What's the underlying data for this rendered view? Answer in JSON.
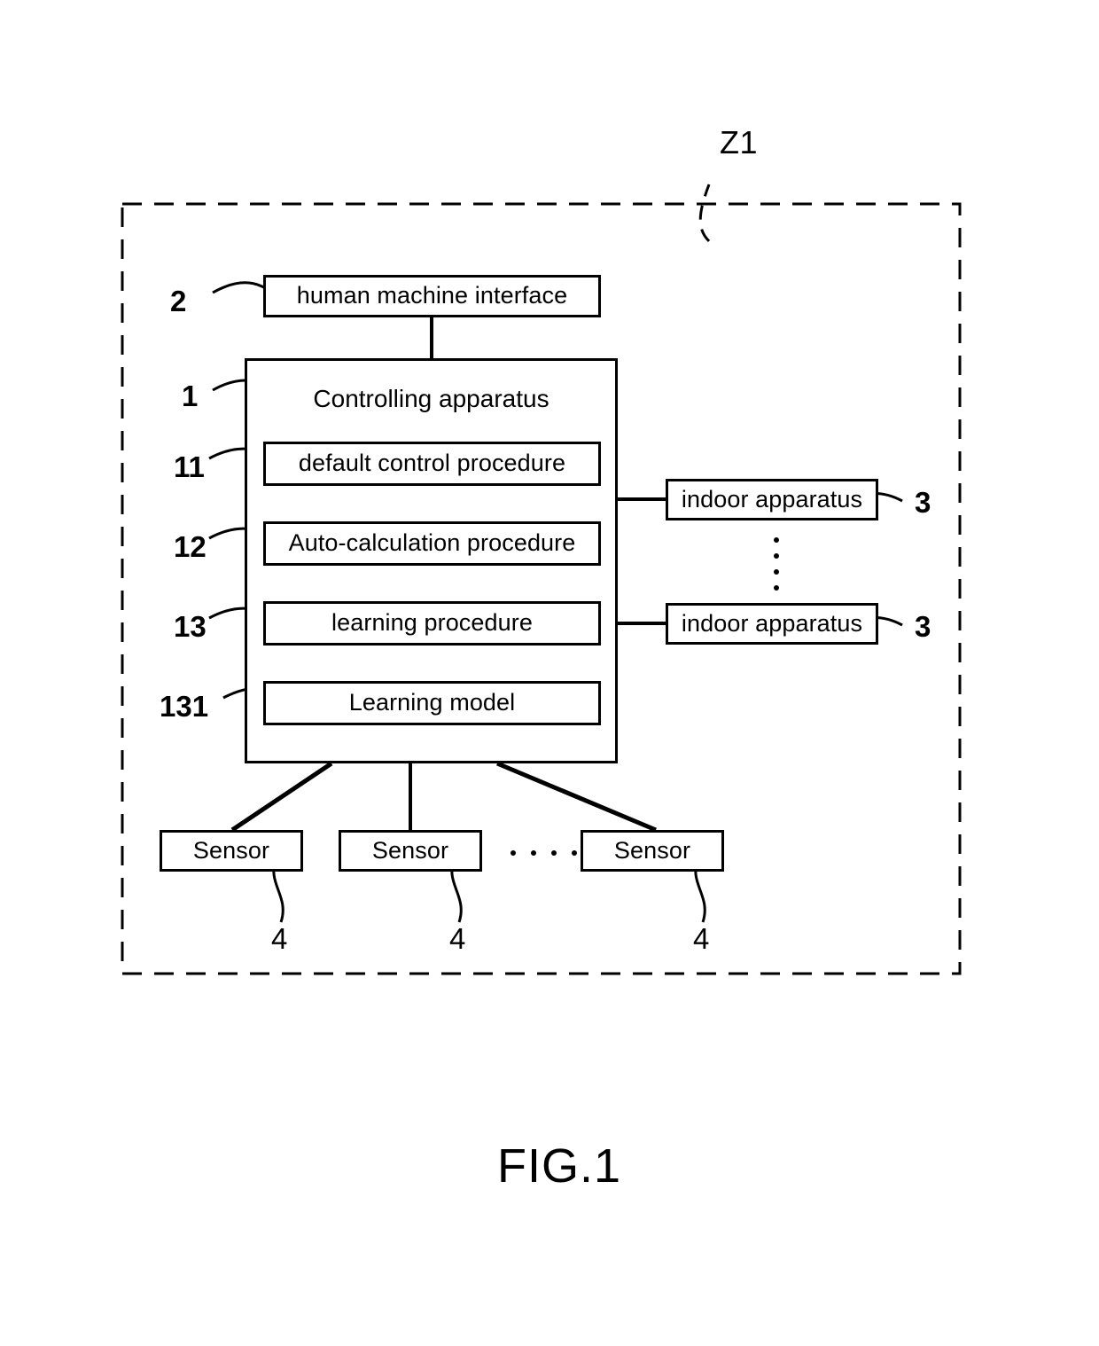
{
  "figure": {
    "caption": "FIG.1",
    "system_label": "Z1"
  },
  "nodes": {
    "hmi": {
      "label": "human machine interface",
      "ref": "2"
    },
    "controller": {
      "label": "Controlling apparatus",
      "ref": "1"
    },
    "default_control": {
      "label": "default control procedure",
      "ref": "11"
    },
    "auto_calculation": {
      "label": "Auto-calculation procedure",
      "ref": "12"
    },
    "learning_procedure": {
      "label": "learning procedure",
      "ref": "13"
    },
    "learning_model": {
      "label": "Learning model",
      "ref": "131"
    },
    "indoor_apparatus_top": {
      "label": "indoor apparatus",
      "ref": "3"
    },
    "indoor_apparatus_bottom": {
      "label": "indoor apparatus",
      "ref": "3"
    },
    "sensor_1": {
      "label": "Sensor",
      "ref": "4"
    },
    "sensor_2": {
      "label": "Sensor",
      "ref": "4"
    },
    "sensor_3": {
      "label": "Sensor",
      "ref": "4"
    }
  },
  "ellipses": {
    "indoor_vertical_dots": 4,
    "sensor_horizontal_dots": 4
  },
  "colors": {
    "stroke": "#000000",
    "background": "#ffffff"
  }
}
